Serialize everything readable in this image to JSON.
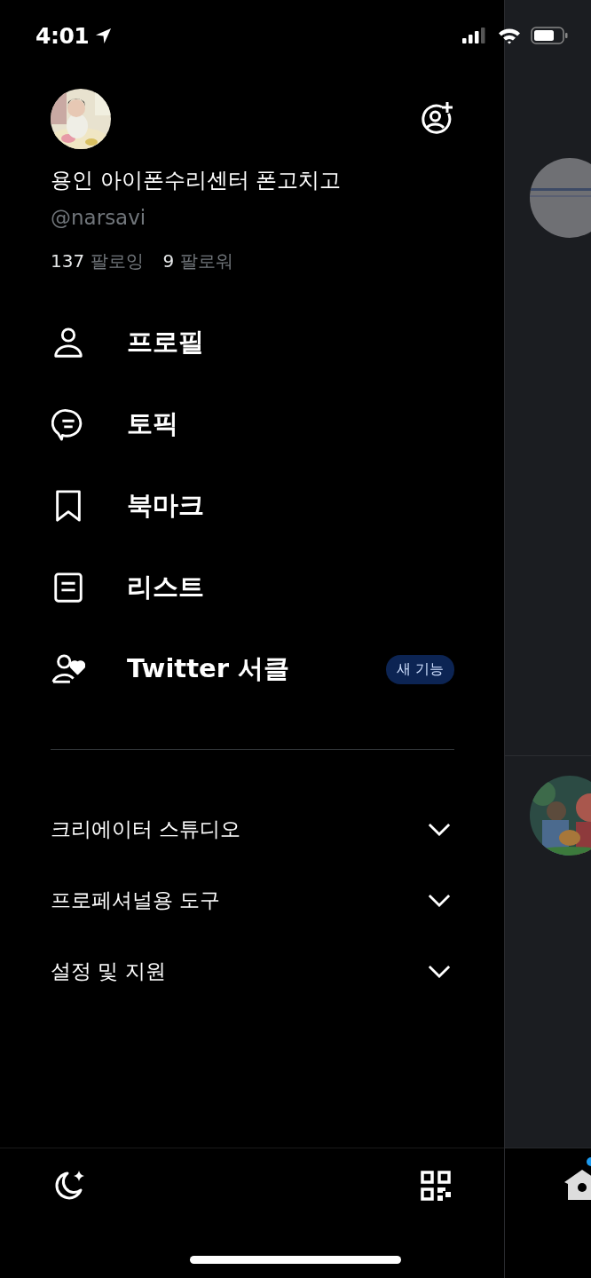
{
  "status_bar": {
    "time": "4:01"
  },
  "profile": {
    "name": "용인 아이폰수리센터 폰고치고",
    "handle": "@narsavi",
    "following_count": "137",
    "following_label": "팔로잉",
    "followers_count": "9",
    "followers_label": "팔로워"
  },
  "menu": [
    {
      "label": "프로필"
    },
    {
      "label": "토픽"
    },
    {
      "label": "북마크"
    },
    {
      "label": "리스트"
    },
    {
      "label": "Twitter 서클",
      "badge": "새 기능"
    }
  ],
  "sections": [
    {
      "label": "크리에이터 스튜디오",
      "expanded": false
    },
    {
      "label": "프로페셔널용 도구",
      "expanded": false
    },
    {
      "label": "설정 및 지원",
      "expanded": false
    }
  ]
}
